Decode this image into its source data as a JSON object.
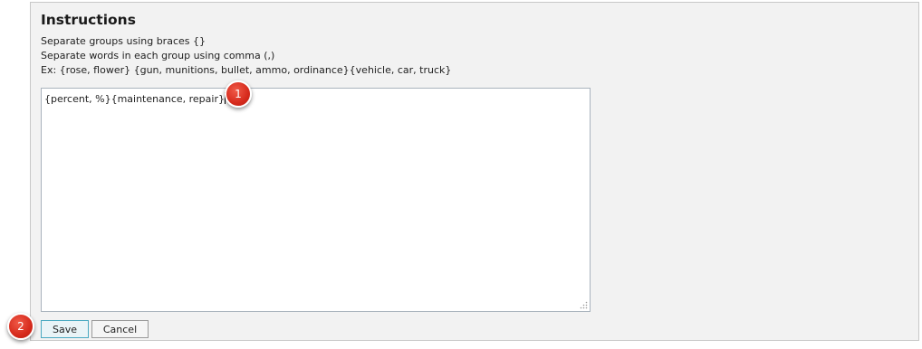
{
  "instructions": {
    "title": "Instructions",
    "line1": "Separate groups using braces {}",
    "line2": "Separate words in each group using comma (,)",
    "line3": "Ex: {rose, flower} {gun, munitions, bullet, ammo, ordinance}{vehicle, car, truck}"
  },
  "editor": {
    "value": "{percent, %}{maintenance, repair}"
  },
  "actions": {
    "save_label": "Save",
    "cancel_label": "Cancel"
  },
  "callouts": {
    "step1": "1",
    "step2": "2"
  },
  "colors": {
    "callout": "#d62a1c",
    "panel_bg": "#f2f2f2",
    "save_border": "#4aa9c1"
  }
}
